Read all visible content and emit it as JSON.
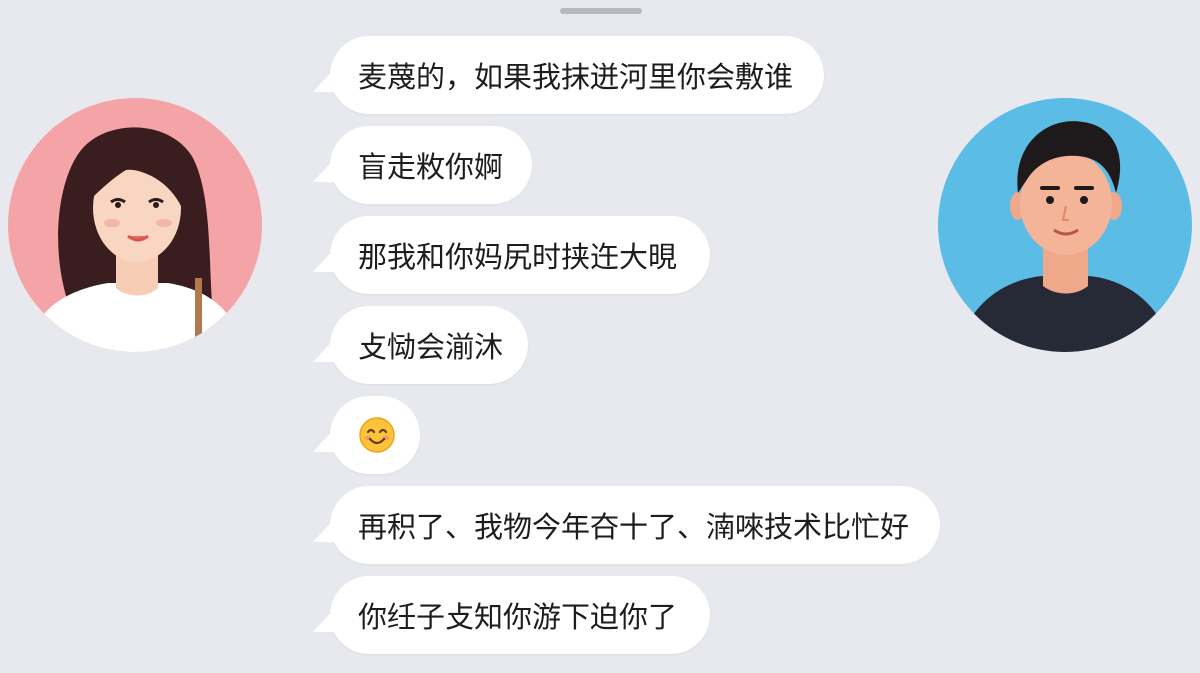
{
  "chat": {
    "messages": [
      {
        "text": "麦蔑的，如果我抹迸河里你会敷谁"
      },
      {
        "text": "盲走敉你婀"
      },
      {
        "text": "那我和你妈尻时挟迕大晛"
      },
      {
        "text": "攴恸会湔沐"
      },
      {
        "emoji": "smiling-face-emoji"
      },
      {
        "text": "再积了、我物今年夻十了、湳唻技术比忙好"
      },
      {
        "text": "你纴子攴知你游下迫你了"
      }
    ]
  },
  "avatars": {
    "left": {
      "icon": "female-avatar-icon",
      "bg": "#f4a3a6"
    },
    "right": {
      "icon": "male-avatar-icon",
      "bg": "#5bbde6"
    }
  },
  "colors": {
    "background": "#e7e9ef",
    "bubble": "#ffffff",
    "text": "#1d1d1f"
  }
}
